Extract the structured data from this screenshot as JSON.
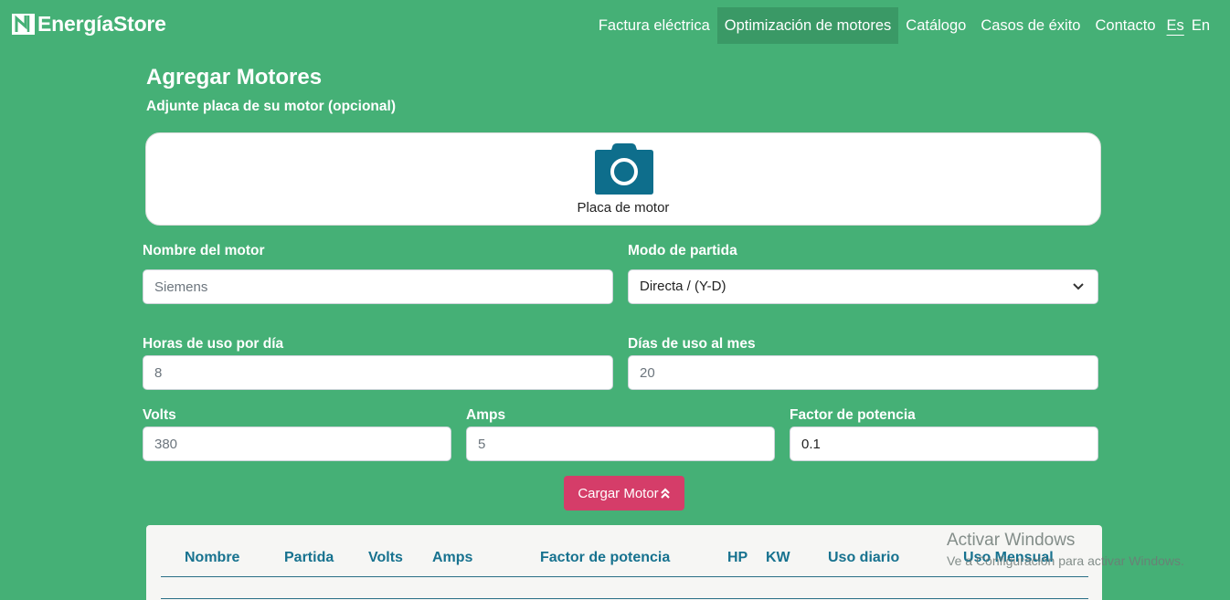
{
  "brand": {
    "name": "EnergíaStore",
    "logo_icon": "n-logo-icon"
  },
  "nav": {
    "items": [
      {
        "label": "Factura eléctrica",
        "active": false
      },
      {
        "label": "Optimización de motores",
        "active": true
      },
      {
        "label": "Catálogo",
        "active": false
      },
      {
        "label": "Casos de éxito",
        "active": false
      },
      {
        "label": "Contacto",
        "active": false
      }
    ],
    "languages": [
      "Es",
      "En"
    ],
    "current_language": "Es"
  },
  "page": {
    "title": "Agregar Motores",
    "subtitle": "Adjunte placa de su motor (opcional)"
  },
  "upload": {
    "icon": "camera-icon",
    "label": "Placa de motor"
  },
  "form": {
    "motor_name": {
      "label": "Nombre del motor",
      "placeholder": "Siemens",
      "value": ""
    },
    "start_mode": {
      "label": "Modo de partida",
      "value": "Directa / (Y-D)"
    },
    "hours_per_day": {
      "label": "Horas de uso por día",
      "placeholder": "8",
      "value": ""
    },
    "days_per_month": {
      "label": "Días de uso al mes",
      "placeholder": "20",
      "value": ""
    },
    "volts": {
      "label": "Volts",
      "placeholder": "380",
      "value": ""
    },
    "amps": {
      "label": "Amps",
      "placeholder": "5",
      "value": ""
    },
    "power_factor": {
      "label": "Factor de potencia",
      "placeholder": "",
      "value": "0.1"
    },
    "submit_label": "Cargar Motor"
  },
  "table": {
    "columns": [
      "Nombre",
      "Partida",
      "Volts",
      "Amps",
      "Factor de potencia",
      "HP",
      "KW",
      "Uso diario",
      "Uso Mensual"
    ]
  },
  "watermark": {
    "title": "Activar Windows",
    "subtitle": "Ve a Configuración para activar Windows."
  },
  "colors": {
    "background": "#45b076",
    "active_nav": "#3a9966",
    "submit_button": "#d53d69",
    "table_header_text": "#17728f",
    "camera_icon": "#0e6e8c"
  }
}
